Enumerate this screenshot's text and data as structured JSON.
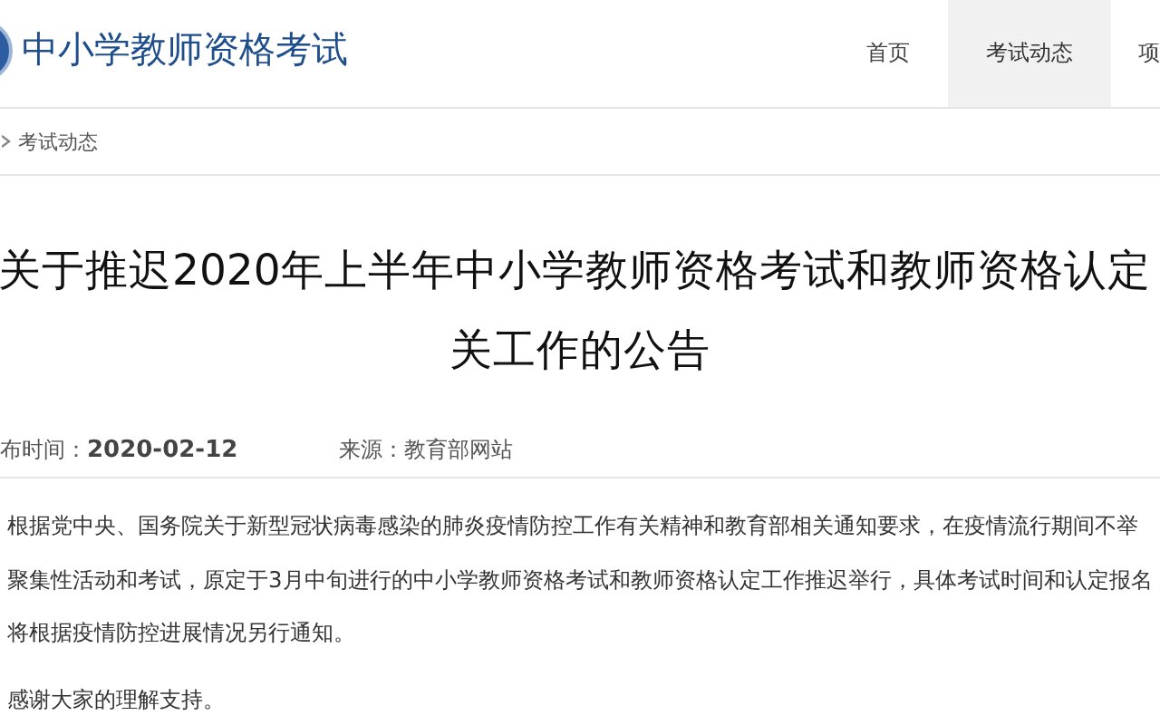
{
  "site": {
    "title": "中小学教师资格考试"
  },
  "nav": [
    {
      "label": "首页",
      "selected": false
    },
    {
      "label": "考试动态",
      "selected": true
    },
    {
      "label": "项",
      "selected": false
    }
  ],
  "breadcrumb": [
    "考试动态"
  ],
  "article": {
    "title_lines": [
      "关于推迟2020年上半年中小学教师资格考试和教师资格认定",
      "关工作的公告"
    ],
    "published_label": "布时间：",
    "published_date": "2020-02-12",
    "source": "来源：教育部网站",
    "paragraph_lines": [
      "根据党中央、国务院关于新型冠状病毒感染的肺炎疫情防控工作有关精神和教育部相关通知要求，在疫情流行期间不举",
      "聚集性活动和考试，原定于3月中旬进行的中小学教师资格考试和教师资格认定工作推迟举行，具体考试时间和认定报名",
      "将根据疫情防控进展情况另行通知。"
    ],
    "closing": "感谢大家的理解支持。"
  }
}
